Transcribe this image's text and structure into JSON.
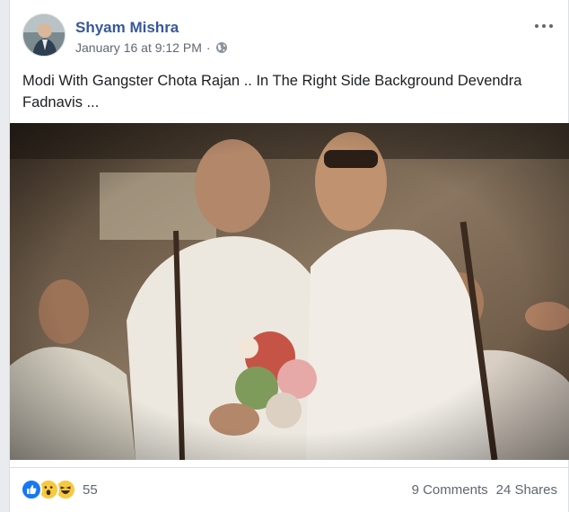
{
  "post": {
    "author": "Shyam Mishra",
    "timestamp": "January 16 at 9:12 PM",
    "separator": "·",
    "privacy_icon": "globe-icon",
    "more_icon": "more-options-icon",
    "text": "Modi With Gangster Chota Rajan .. In The Right Side Background Devendra Fadnavis ...",
    "image_alt": "Photo of men in white shirts, one holding a bouquet of flowers"
  },
  "footer": {
    "reaction_icons": [
      "like-icon",
      "wow-icon",
      "haha-icon"
    ],
    "reaction_count": "55",
    "comments": "9 Comments",
    "shares": "24 Shares"
  },
  "colors": {
    "link": "#385898",
    "secondary_text": "#606770",
    "like_blue": "#1877f2",
    "emoji_yellow": "#f7c93e"
  }
}
